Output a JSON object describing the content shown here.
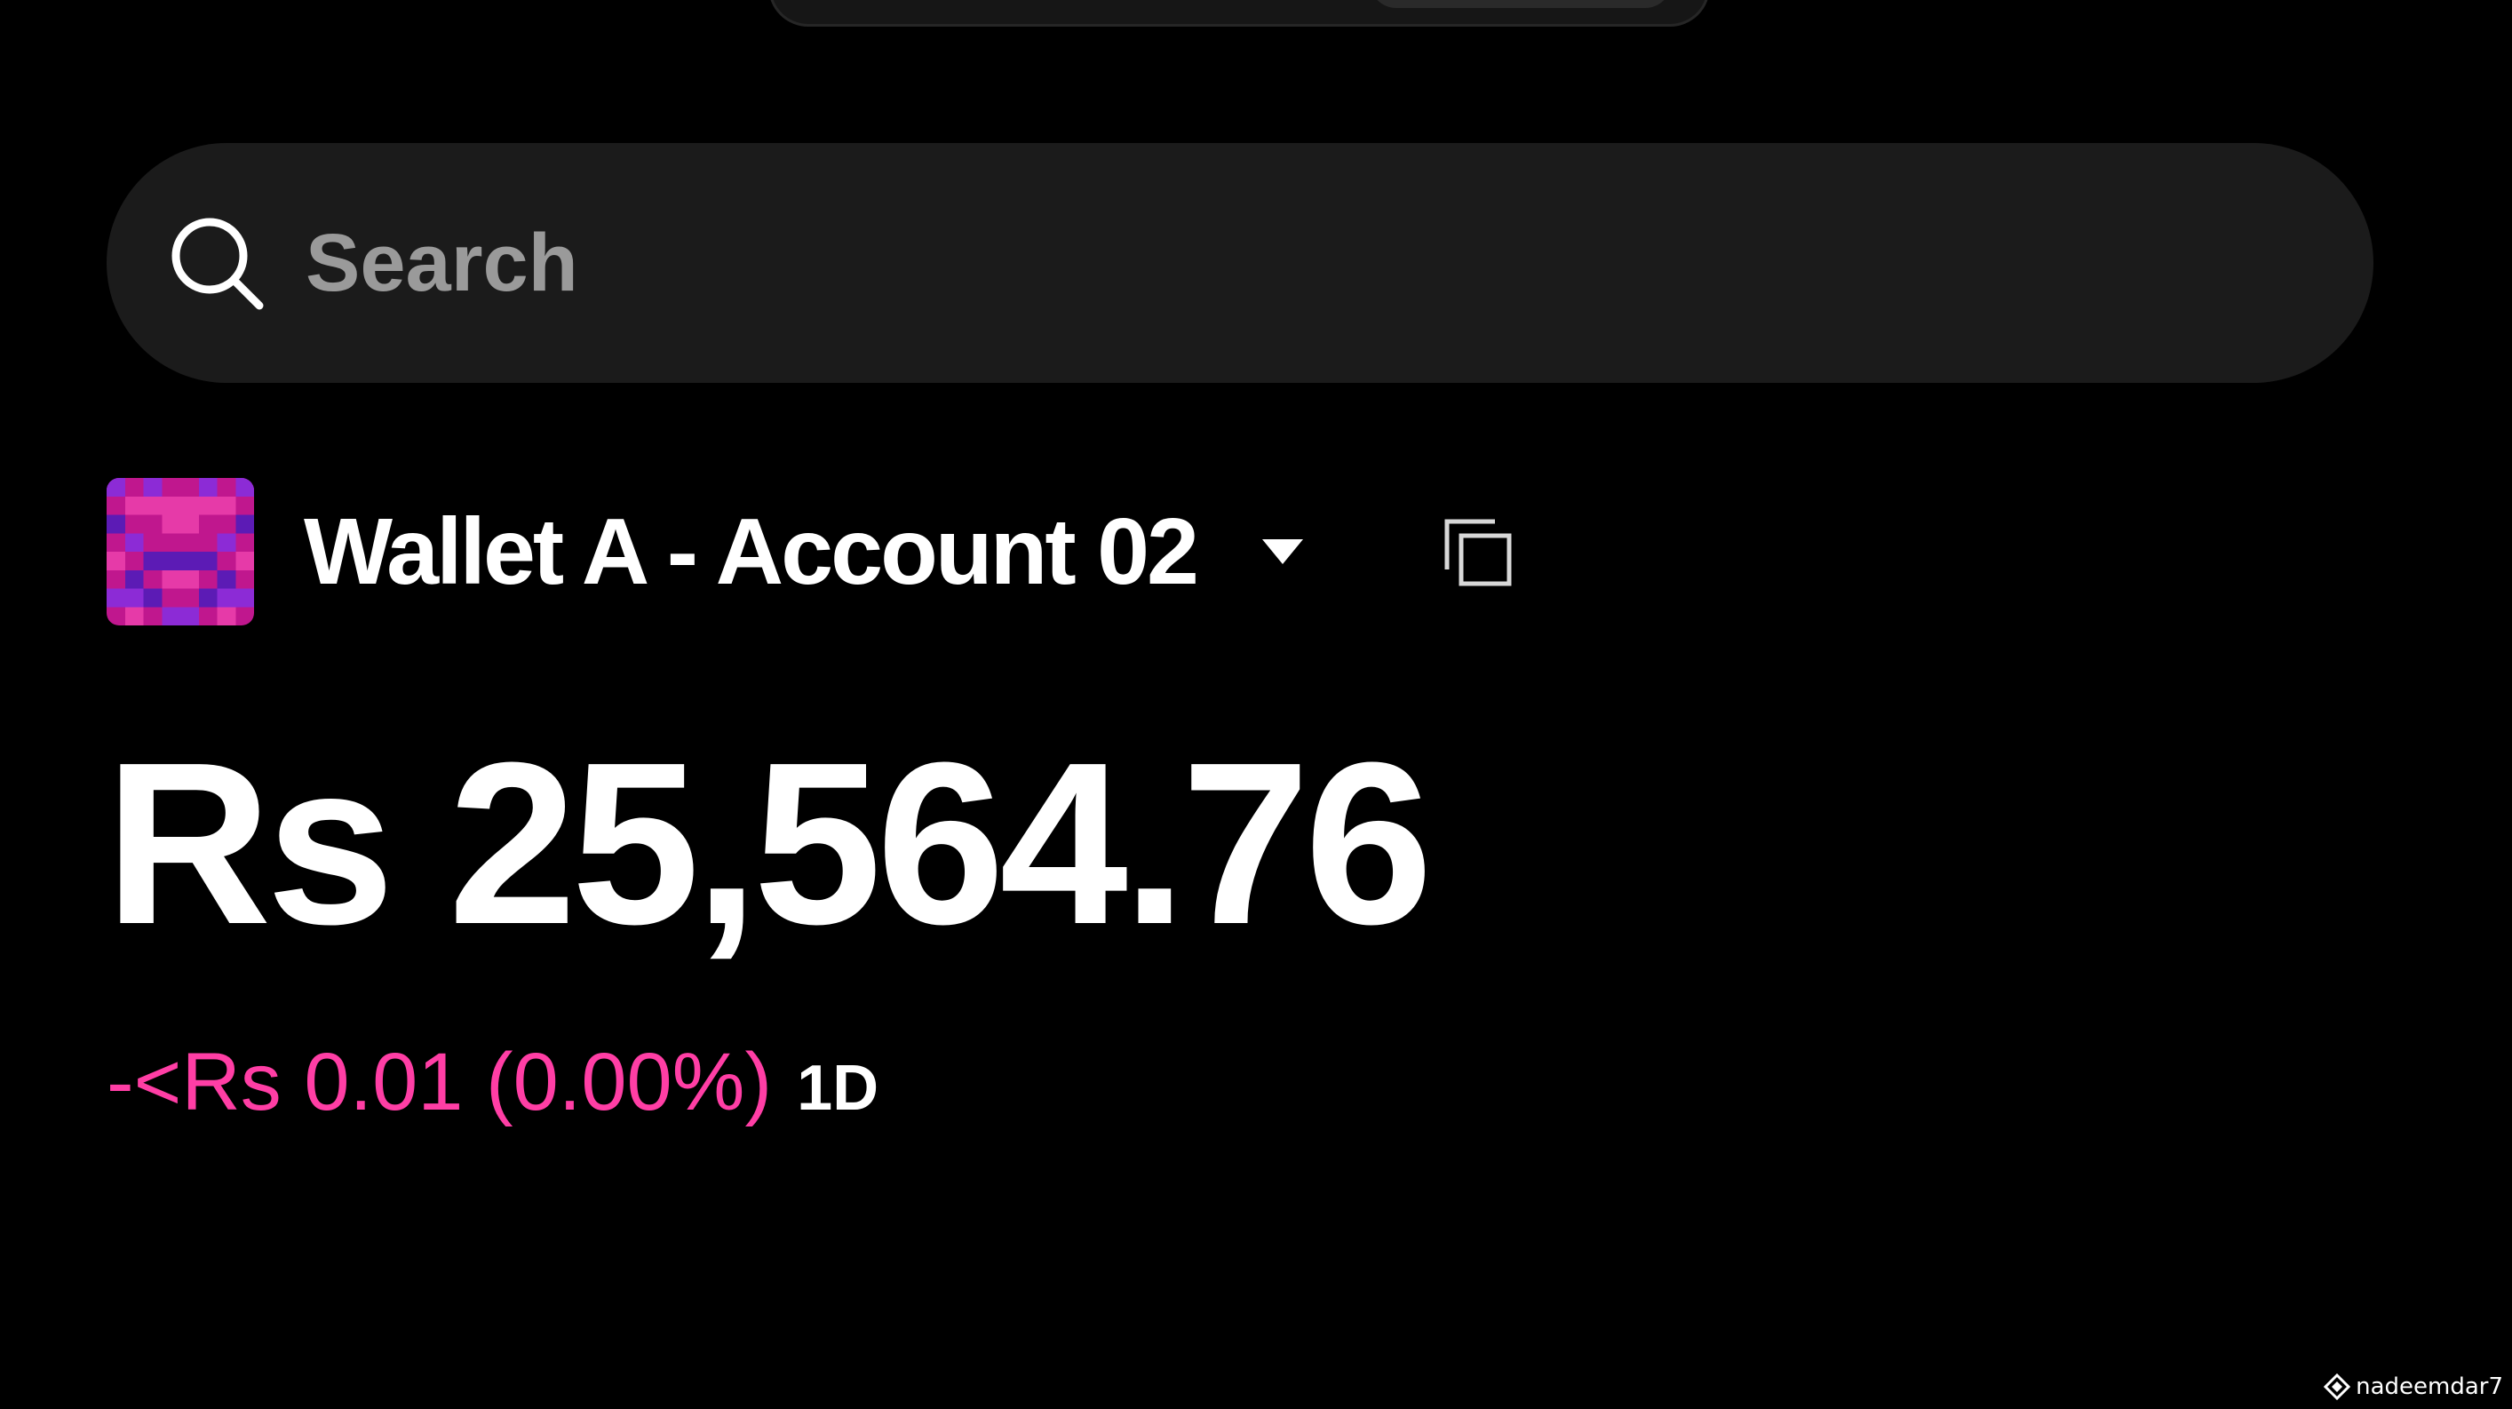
{
  "search": {
    "placeholder": "Search",
    "icon": "search-icon"
  },
  "account": {
    "name": "Wallet A - Account 02",
    "avatar_colors": [
      "#c0178e",
      "#8c2bd6",
      "#e63aa8",
      "#5c1bb5"
    ],
    "dropdown_icon": "chevron-down-icon",
    "copy_icon": "copy-icon"
  },
  "balance": {
    "amount": "Rs 25,564.76"
  },
  "change": {
    "value": "-<Rs 0.01 (0.00%)",
    "period": "1D",
    "color": "#ff3ea5"
  },
  "watermark": {
    "text": "nadeemdar7"
  }
}
